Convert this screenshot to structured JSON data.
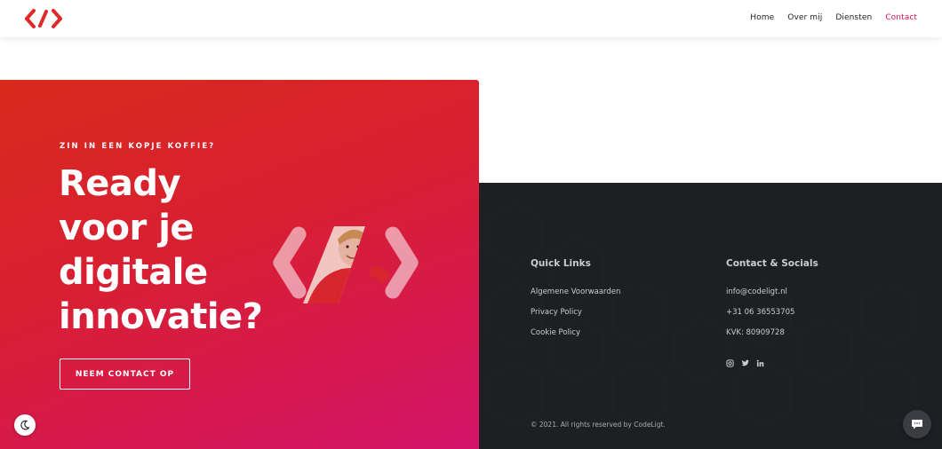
{
  "header": {
    "logo_icon": "brackets-slash-logo",
    "nav": [
      {
        "label": "Home",
        "active": false
      },
      {
        "label": "Over mij",
        "active": false
      },
      {
        "label": "Diensten",
        "active": false
      },
      {
        "label": "Contact",
        "active": true
      }
    ]
  },
  "hero": {
    "eyebrow": "ZIN IN EEN KOPJE KOFFIE?",
    "headline_lines": [
      "Ready",
      "voor je",
      "digitale",
      "innovatie?"
    ],
    "cta_label": "NEEM CONTACT OP",
    "logo_icon": "brackets-portrait-logo"
  },
  "footer": {
    "quick_links": {
      "title": "Quick Links",
      "items": [
        "Algemene Voorwaarden",
        "Privacy Policy",
        "Cookie Policy"
      ]
    },
    "contact": {
      "title": "Contact & Socials",
      "email": "info@codeligt.nl",
      "phone": "+31 06 36553705",
      "kvk": "KVK: 80909728",
      "socials": [
        "instagram-icon",
        "twitter-icon",
        "linkedin-icon"
      ]
    },
    "copyright": "© 2021. All rights reserved by CodeLigt."
  },
  "widgets": {
    "theme_toggle_icon": "moon-icon",
    "chat_icon": "chat-bubble-icon"
  },
  "colors": {
    "accent": "#d6115a",
    "hero_start": "#d92a1c",
    "hero_end": "#d4146a",
    "footer_bg": "#1e1f23",
    "footer_text": "#c9ccd2"
  }
}
